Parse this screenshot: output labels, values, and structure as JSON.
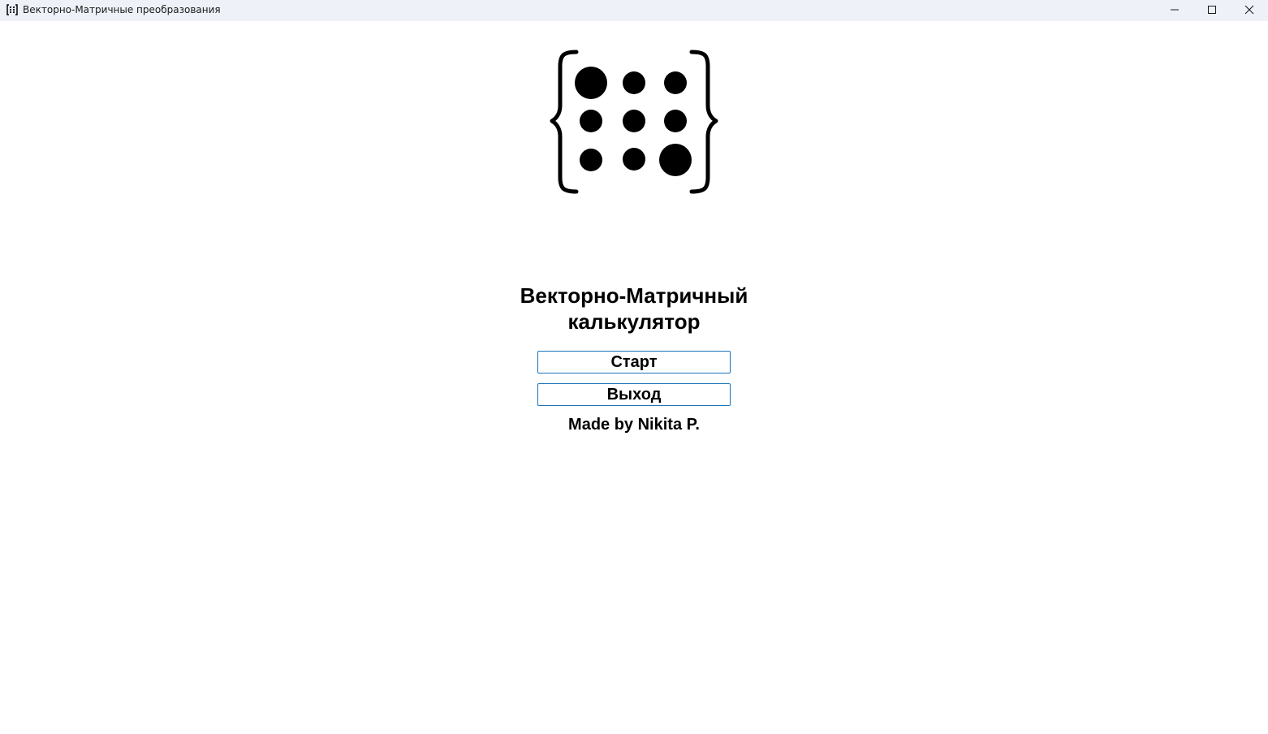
{
  "window": {
    "title": "Векторно-Матричные преобразования",
    "app_icon": "matrix-brackets-icon",
    "controls": [
      "minimize-icon",
      "maximize-icon",
      "close-icon"
    ]
  },
  "main": {
    "logo": "matrix-logo",
    "title_line1": "Векторно-Матричный",
    "title_line2": "калькулятор",
    "start_label": "Старт",
    "exit_label": "Выход",
    "credit": "Made by Nikita P."
  },
  "colors": {
    "titlebar_bg": "#eef2f8",
    "button_border": "#1a73b8",
    "text": "#000000"
  }
}
